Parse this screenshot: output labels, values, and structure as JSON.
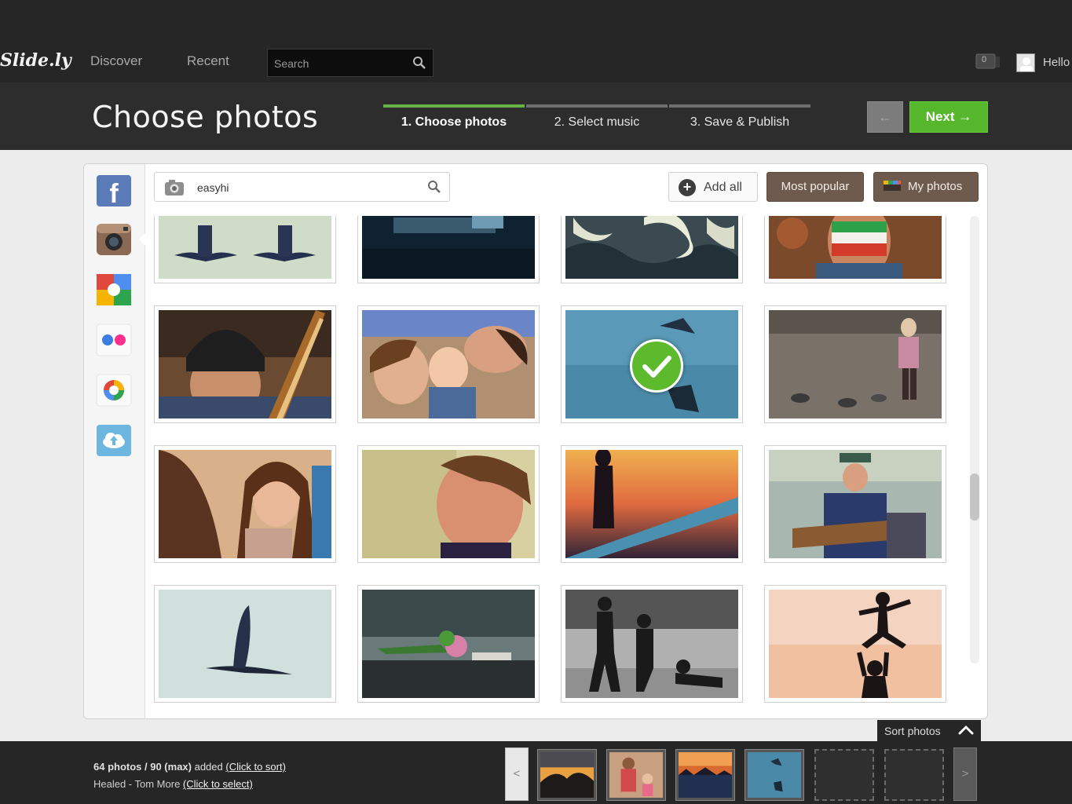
{
  "topbar": {
    "logo": "Slide.ly",
    "nav": [
      "Discover",
      "Recent"
    ],
    "search_placeholder": "Search",
    "notification_count": "0",
    "greeting": "Hello"
  },
  "header": {
    "title": "Choose photos",
    "steps": [
      "1. Choose photos",
      "2. Select music",
      "3. Save & Publish"
    ],
    "prev_label": "←",
    "next_label": "Next →"
  },
  "sources": [
    "facebook",
    "instagram",
    "google",
    "flickr",
    "picasa",
    "cloud-upload"
  ],
  "toolbar": {
    "filter_value": "easyhi",
    "add_all": "Add all",
    "most_popular": "Most popular",
    "my_photos": "My photos"
  },
  "photos": [
    {
      "subject": "birds-mirrored",
      "selected": false
    },
    {
      "subject": "dark-window",
      "selected": false
    },
    {
      "subject": "swans",
      "selected": false
    },
    {
      "subject": "face-paint",
      "selected": false
    },
    {
      "subject": "guitarist-beanie",
      "selected": false
    },
    {
      "subject": "family-baby",
      "selected": false
    },
    {
      "subject": "bird-water",
      "selected": true
    },
    {
      "subject": "child-pigeons",
      "selected": false
    },
    {
      "subject": "girls-laughing",
      "selected": false
    },
    {
      "subject": "boy-sunlit",
      "selected": false
    },
    {
      "subject": "sunset-silhouette",
      "selected": false
    },
    {
      "subject": "street-musician",
      "selected": false
    },
    {
      "subject": "bird-flying",
      "selected": false
    },
    {
      "subject": "flowers-bench",
      "selected": false
    },
    {
      "subject": "kids-beach",
      "selected": false
    },
    {
      "subject": "father-throw",
      "selected": false
    }
  ],
  "sort": {
    "label": "Sort photos"
  },
  "bottom": {
    "count_text": "64 photos / 90 (max)",
    "added": " added ",
    "click_sort": "(Click to sort)",
    "song": "Healed - Tom More ",
    "click_select": "(Click to select)",
    "left_arrow": "<",
    "right_arrow": ">"
  },
  "colors": {
    "accent": "#56b72c",
    "brown": "#6e5b4e",
    "dark": "#262626"
  }
}
